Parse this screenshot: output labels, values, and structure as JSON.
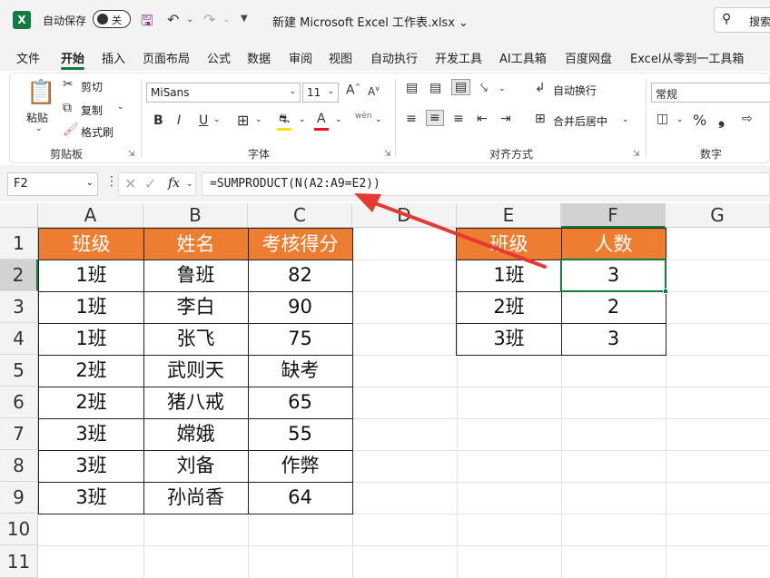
{
  "titlebar": {
    "logo": "X",
    "autosave_label": "自动保存",
    "autosave_state": "关",
    "filename": "新建 Microsoft Excel 工作表.xlsx",
    "search_label": "搜索"
  },
  "tabs": [
    "文件",
    "开始",
    "插入",
    "页面布局",
    "公式",
    "数据",
    "审阅",
    "视图",
    "自动执行",
    "开发工具",
    "AI工具箱",
    "百度网盘",
    "Excel从零到一工具箱"
  ],
  "active_tab": "开始",
  "ribbon": {
    "clipboard": {
      "paste": "粘贴",
      "cut": "剪切",
      "copy": "复制",
      "format_painter": "格式刷",
      "label": "剪贴板"
    },
    "font": {
      "name": "MiSans",
      "size": "11",
      "grow": "A",
      "shrink": "A",
      "bold": "B",
      "italic": "I",
      "underline": "U",
      "color_letter": "A",
      "wen": "wén",
      "label": "字体"
    },
    "alignment": {
      "wrap": "自动换行",
      "merge": "合并后居中",
      "label": "对齐方式"
    },
    "number": {
      "format": "常规",
      "percent": "%",
      "comma": "❟",
      "label": "数字"
    }
  },
  "formula_bar": {
    "name_box": "F2",
    "fx": "fx",
    "formula": "=SUMPRODUCT(N(A2:A9=E2))"
  },
  "grid": {
    "columns": [
      "A",
      "B",
      "C",
      "D",
      "E",
      "F",
      "G"
    ],
    "rows": [
      "1",
      "2",
      "3",
      "4",
      "5",
      "6",
      "7",
      "8",
      "9",
      "10",
      "11"
    ],
    "selected_cell": "F2",
    "table1": {
      "headers": [
        "班级",
        "姓名",
        "考核得分"
      ],
      "rows": [
        [
          "1班",
          "鲁班",
          "82"
        ],
        [
          "1班",
          "李白",
          "90"
        ],
        [
          "1班",
          "张飞",
          "75"
        ],
        [
          "2班",
          "武则天",
          "缺考"
        ],
        [
          "2班",
          "猪八戒",
          "65"
        ],
        [
          "3班",
          "嫦娥",
          "55"
        ],
        [
          "3班",
          "刘备",
          "作弊"
        ],
        [
          "3班",
          "孙尚香",
          "64"
        ]
      ]
    },
    "table2": {
      "headers": [
        "班级",
        "人数"
      ],
      "rows": [
        [
          "1班",
          "3"
        ],
        [
          "2班",
          "2"
        ],
        [
          "3班",
          "3"
        ]
      ]
    },
    "header_fill": "#ED7D31",
    "accent": "#107C41"
  }
}
